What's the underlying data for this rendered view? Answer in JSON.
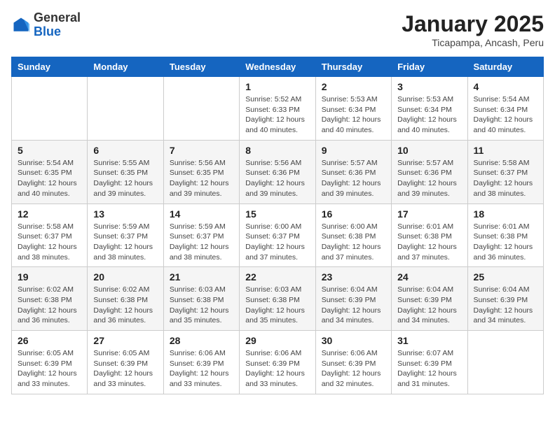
{
  "logo": {
    "general": "General",
    "blue": "Blue"
  },
  "header": {
    "title": "January 2025",
    "location": "Ticapampa, Ancash, Peru"
  },
  "weekdays": [
    "Sunday",
    "Monday",
    "Tuesday",
    "Wednesday",
    "Thursday",
    "Friday",
    "Saturday"
  ],
  "weeks": [
    [
      {
        "day": "",
        "info": ""
      },
      {
        "day": "",
        "info": ""
      },
      {
        "day": "",
        "info": ""
      },
      {
        "day": "1",
        "info": "Sunrise: 5:52 AM\nSunset: 6:33 PM\nDaylight: 12 hours\nand 40 minutes."
      },
      {
        "day": "2",
        "info": "Sunrise: 5:53 AM\nSunset: 6:34 PM\nDaylight: 12 hours\nand 40 minutes."
      },
      {
        "day": "3",
        "info": "Sunrise: 5:53 AM\nSunset: 6:34 PM\nDaylight: 12 hours\nand 40 minutes."
      },
      {
        "day": "4",
        "info": "Sunrise: 5:54 AM\nSunset: 6:34 PM\nDaylight: 12 hours\nand 40 minutes."
      }
    ],
    [
      {
        "day": "5",
        "info": "Sunrise: 5:54 AM\nSunset: 6:35 PM\nDaylight: 12 hours\nand 40 minutes."
      },
      {
        "day": "6",
        "info": "Sunrise: 5:55 AM\nSunset: 6:35 PM\nDaylight: 12 hours\nand 39 minutes."
      },
      {
        "day": "7",
        "info": "Sunrise: 5:56 AM\nSunset: 6:35 PM\nDaylight: 12 hours\nand 39 minutes."
      },
      {
        "day": "8",
        "info": "Sunrise: 5:56 AM\nSunset: 6:36 PM\nDaylight: 12 hours\nand 39 minutes."
      },
      {
        "day": "9",
        "info": "Sunrise: 5:57 AM\nSunset: 6:36 PM\nDaylight: 12 hours\nand 39 minutes."
      },
      {
        "day": "10",
        "info": "Sunrise: 5:57 AM\nSunset: 6:36 PM\nDaylight: 12 hours\nand 39 minutes."
      },
      {
        "day": "11",
        "info": "Sunrise: 5:58 AM\nSunset: 6:37 PM\nDaylight: 12 hours\nand 38 minutes."
      }
    ],
    [
      {
        "day": "12",
        "info": "Sunrise: 5:58 AM\nSunset: 6:37 PM\nDaylight: 12 hours\nand 38 minutes."
      },
      {
        "day": "13",
        "info": "Sunrise: 5:59 AM\nSunset: 6:37 PM\nDaylight: 12 hours\nand 38 minutes."
      },
      {
        "day": "14",
        "info": "Sunrise: 5:59 AM\nSunset: 6:37 PM\nDaylight: 12 hours\nand 38 minutes."
      },
      {
        "day": "15",
        "info": "Sunrise: 6:00 AM\nSunset: 6:37 PM\nDaylight: 12 hours\nand 37 minutes."
      },
      {
        "day": "16",
        "info": "Sunrise: 6:00 AM\nSunset: 6:38 PM\nDaylight: 12 hours\nand 37 minutes."
      },
      {
        "day": "17",
        "info": "Sunrise: 6:01 AM\nSunset: 6:38 PM\nDaylight: 12 hours\nand 37 minutes."
      },
      {
        "day": "18",
        "info": "Sunrise: 6:01 AM\nSunset: 6:38 PM\nDaylight: 12 hours\nand 36 minutes."
      }
    ],
    [
      {
        "day": "19",
        "info": "Sunrise: 6:02 AM\nSunset: 6:38 PM\nDaylight: 12 hours\nand 36 minutes."
      },
      {
        "day": "20",
        "info": "Sunrise: 6:02 AM\nSunset: 6:38 PM\nDaylight: 12 hours\nand 36 minutes."
      },
      {
        "day": "21",
        "info": "Sunrise: 6:03 AM\nSunset: 6:38 PM\nDaylight: 12 hours\nand 35 minutes."
      },
      {
        "day": "22",
        "info": "Sunrise: 6:03 AM\nSunset: 6:38 PM\nDaylight: 12 hours\nand 35 minutes."
      },
      {
        "day": "23",
        "info": "Sunrise: 6:04 AM\nSunset: 6:39 PM\nDaylight: 12 hours\nand 34 minutes."
      },
      {
        "day": "24",
        "info": "Sunrise: 6:04 AM\nSunset: 6:39 PM\nDaylight: 12 hours\nand 34 minutes."
      },
      {
        "day": "25",
        "info": "Sunrise: 6:04 AM\nSunset: 6:39 PM\nDaylight: 12 hours\nand 34 minutes."
      }
    ],
    [
      {
        "day": "26",
        "info": "Sunrise: 6:05 AM\nSunset: 6:39 PM\nDaylight: 12 hours\nand 33 minutes."
      },
      {
        "day": "27",
        "info": "Sunrise: 6:05 AM\nSunset: 6:39 PM\nDaylight: 12 hours\nand 33 minutes."
      },
      {
        "day": "28",
        "info": "Sunrise: 6:06 AM\nSunset: 6:39 PM\nDaylight: 12 hours\nand 33 minutes."
      },
      {
        "day": "29",
        "info": "Sunrise: 6:06 AM\nSunset: 6:39 PM\nDaylight: 12 hours\nand 33 minutes."
      },
      {
        "day": "30",
        "info": "Sunrise: 6:06 AM\nSunset: 6:39 PM\nDaylight: 12 hours\nand 32 minutes."
      },
      {
        "day": "31",
        "info": "Sunrise: 6:07 AM\nSunset: 6:39 PM\nDaylight: 12 hours\nand 31 minutes."
      },
      {
        "day": "",
        "info": ""
      }
    ]
  ]
}
